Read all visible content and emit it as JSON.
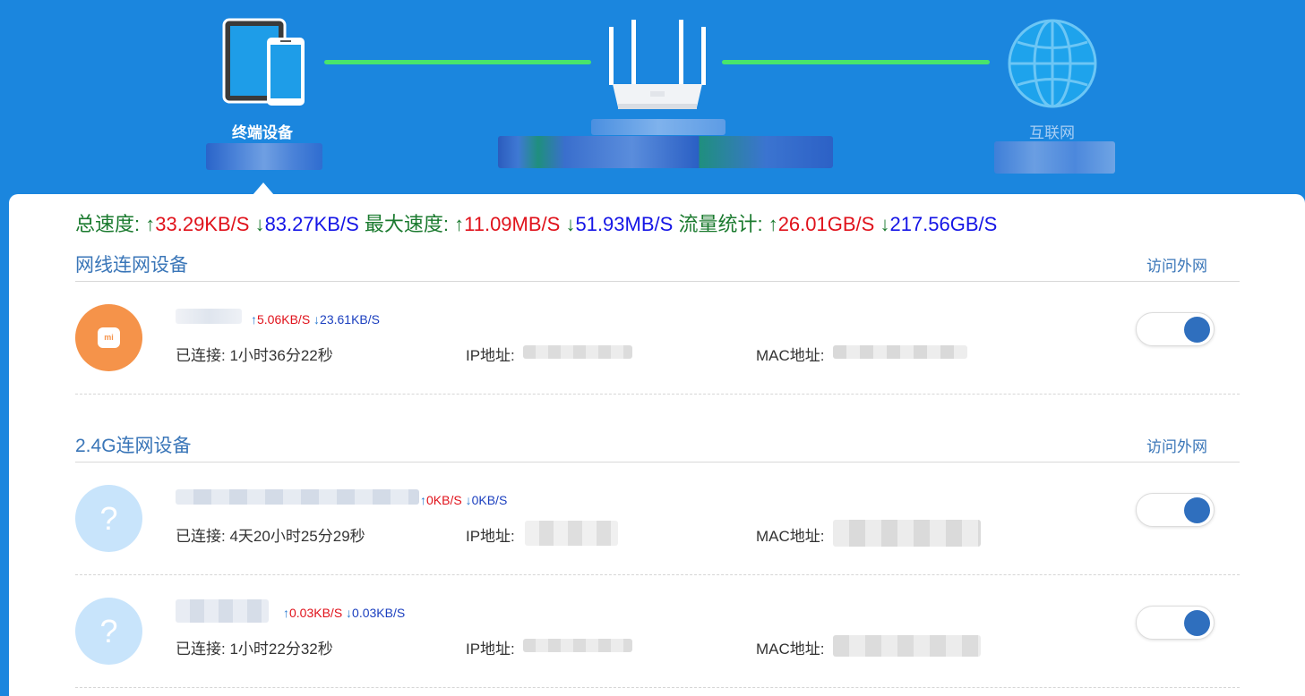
{
  "topology": {
    "device_label": "终端设备",
    "internet_label": "互联网",
    "icons": [
      "devices-icon",
      "router-icon",
      "globe-icon"
    ],
    "colors": {
      "background": "#1b86de",
      "link_line": "#48e46c"
    }
  },
  "totals": {
    "total_label": "总速度:",
    "total_up": "33.29KB/S",
    "total_down": "83.27KB/S",
    "max_label": "最大速度:",
    "max_up": "11.09MB/S",
    "max_down": "51.93MB/S",
    "traffic_label": "流量统计:",
    "traffic_up": "26.01GB/S",
    "traffic_down": "217.56GB/S",
    "arrow_up": "↑",
    "arrow_down": "↓"
  },
  "sections": [
    {
      "title": "网线连网设备",
      "link": "访问外网",
      "devices": [
        {
          "avatar": "xiaomi-icon",
          "logo_text": "mi",
          "up": "5.06KB/S",
          "down": "23.61KB/S",
          "connected_label": "已连接:",
          "connected": "1小时36分22秒",
          "ip_label": "IP地址:",
          "mac_label": "MAC地址:",
          "enabled": true
        }
      ]
    },
    {
      "title": "2.4G连网设备",
      "link": "访问外网",
      "devices": [
        {
          "avatar": "question-icon",
          "logo_text": "?",
          "up": "0KB/S",
          "down": "0KB/S",
          "connected_label": "已连接:",
          "connected": "4天20小时25分29秒",
          "ip_label": "IP地址:",
          "mac_label": "MAC地址:",
          "enabled": true
        },
        {
          "avatar": "question-icon",
          "logo_text": "?",
          "up": "0.03KB/S",
          "down": "0.03KB/S",
          "connected_label": "已连接:",
          "connected": "1小时22分32秒",
          "ip_label": "IP地址:",
          "mac_label": "MAC地址:",
          "enabled": true
        }
      ]
    }
  ]
}
